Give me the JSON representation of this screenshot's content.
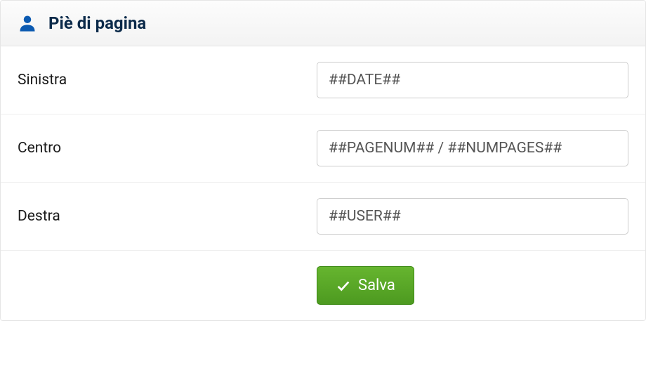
{
  "header": {
    "title": "Piè di pagina"
  },
  "fields": {
    "left": {
      "label": "Sinistra",
      "value": "##DATE##"
    },
    "center": {
      "label": "Centro",
      "value": "##PAGENUM## / ##NUMPAGES##"
    },
    "right": {
      "label": "Destra",
      "value": "##USER##"
    }
  },
  "actions": {
    "save_label": "Salva"
  }
}
